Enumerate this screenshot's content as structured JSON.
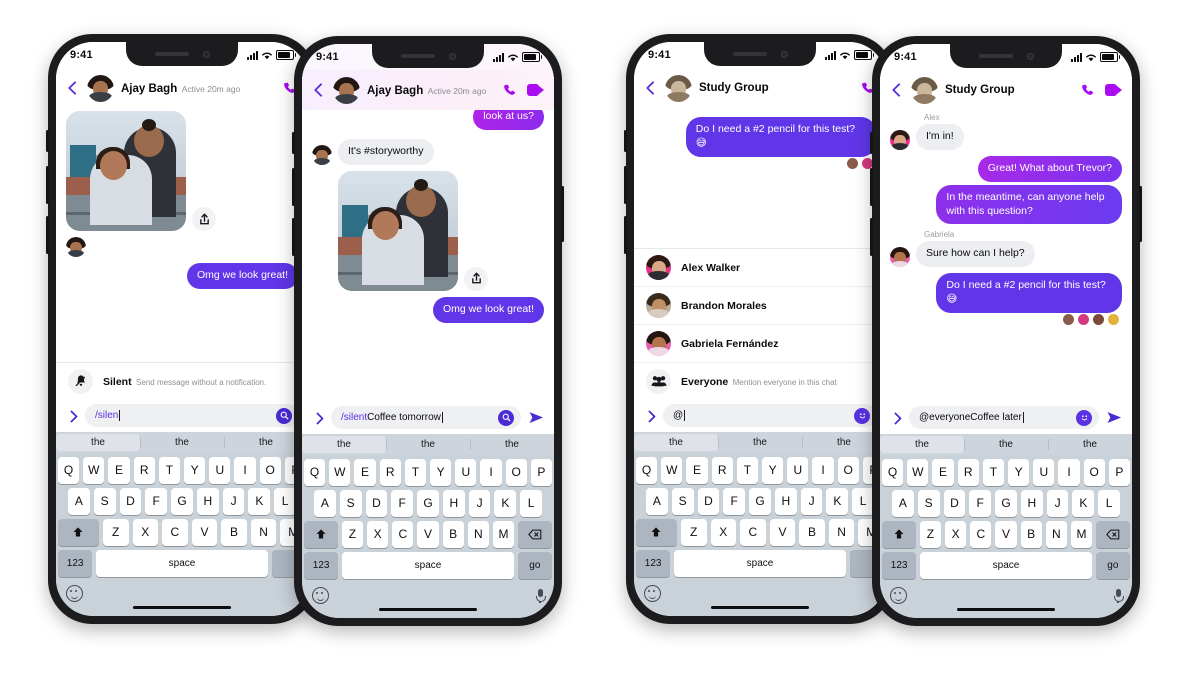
{
  "status_bar": {
    "time": "9:41",
    "signal_icon": "cellular-bars-icon",
    "wifi_icon": "wifi-icon",
    "battery_icon": "battery-icon"
  },
  "keyboard": {
    "predictions": [
      "the",
      "the",
      "the"
    ],
    "row1": [
      "Q",
      "W",
      "E",
      "R",
      "T",
      "Y",
      "U",
      "I",
      "O",
      "P"
    ],
    "row2": [
      "A",
      "S",
      "D",
      "F",
      "G",
      "H",
      "J",
      "K",
      "L"
    ],
    "row3_shift": "shift-icon",
    "row3": [
      "Z",
      "X",
      "C",
      "V",
      "B",
      "N",
      "M"
    ],
    "row3_delete": "delete-icon",
    "numeric_key": "123",
    "space_key": "space",
    "action_key": "go",
    "emoji_key": "emoji-icon",
    "mic_key": "microphone-icon"
  },
  "phones": [
    {
      "id": "phone-1",
      "header": {
        "name": "Ajay Bagh",
        "status": "Active 20m ago",
        "back": "back-icon",
        "call": "phone-call-icon",
        "avatar": "contact-avatar",
        "gradient": false,
        "video_visible": false
      },
      "messages": [
        {
          "type": "photo",
          "side": "in",
          "share": "share-icon",
          "caption": "rooftop-photo"
        },
        {
          "type": "text",
          "side": "out",
          "text": "Omg we look great!",
          "style": "solid"
        }
      ],
      "sheet": {
        "type": "command",
        "icon": "bell-slash-icon",
        "title": "Silent",
        "subtitle": "Send message without a notification."
      },
      "composer": {
        "command": "/silen",
        "rest": "",
        "placeholder": "Aa",
        "left_icon": "chevron-right-icon",
        "right_icon": "search-icon",
        "send_visible": false
      },
      "keyboard_clipped": true
    },
    {
      "id": "phone-2",
      "header": {
        "name": "Ajay Bagh",
        "status": "Active 20m ago",
        "back": "back-icon",
        "call": "phone-call-icon",
        "avatar": "contact-avatar",
        "gradient": true,
        "video_visible": true
      },
      "messages": [
        {
          "type": "text",
          "side": "out",
          "text": "look at us?",
          "style": "grad-a",
          "clipped": true
        },
        {
          "type": "text",
          "side": "in",
          "text": "It's #storyworthy"
        },
        {
          "type": "photo",
          "side": "in",
          "share": "share-icon",
          "caption": "rooftop-photo"
        },
        {
          "type": "text",
          "side": "out",
          "text": "Omg we look great!",
          "style": "solid"
        }
      ],
      "sheet": null,
      "composer": {
        "command": "/silent",
        "rest": " Coffee tomorrow",
        "left_icon": "chevron-right-icon",
        "right_icon": "search-icon",
        "send_visible": true,
        "send_icon": "send-icon"
      },
      "keyboard_clipped": true
    },
    {
      "id": "phone-3",
      "header": {
        "name": "Study Group",
        "status": "",
        "back": "back-icon",
        "call": "phone-call-icon",
        "avatar": "group-avatar",
        "gradient": false,
        "video_visible": false
      },
      "messages": [
        {
          "type": "text",
          "side": "out",
          "text": "Do I need a #2 pencil for this test? 😅",
          "style": "solid"
        }
      ],
      "reactions": 2,
      "sheet": {
        "type": "mentions",
        "items": [
          {
            "name": "Alex Walker",
            "subtitle": "",
            "avatar": "avatar-alex"
          },
          {
            "name": "Brandon Morales",
            "subtitle": "",
            "avatar": "avatar-brandon"
          },
          {
            "name": "Gabriela Fernández",
            "subtitle": "",
            "avatar": "avatar-gabriela"
          },
          {
            "name": "Everyone",
            "subtitle": "Mention everyone in this chat",
            "avatar": "group-people-icon"
          }
        ]
      },
      "composer": {
        "command": "@",
        "rest": "",
        "left_icon": "chevron-right-icon",
        "right_icon": "emoji-icon",
        "send_visible": false
      },
      "keyboard_clipped": true
    },
    {
      "id": "phone-4",
      "header": {
        "name": "Study Group",
        "status": "",
        "back": "back-icon",
        "call": "phone-call-icon",
        "avatar": "group-avatar",
        "gradient": false,
        "video_visible": true
      },
      "messages": [
        {
          "type": "text",
          "side": "in",
          "sender": "Alex",
          "text": "I'm in!"
        },
        {
          "type": "text",
          "side": "out",
          "text": "Great! What about Trevor?",
          "style": "grad-b"
        },
        {
          "type": "text",
          "side": "out",
          "text": "In the meantime, can anyone help with this question?",
          "style": "grad-c"
        },
        {
          "type": "text",
          "side": "in",
          "sender": "Gabriela",
          "text": "Sure how can I help?"
        },
        {
          "type": "text",
          "side": "out",
          "text": "Do I need a #2 pencil for this test? 😅",
          "style": "solid"
        }
      ],
      "reactions": 4,
      "sheet": null,
      "composer": {
        "command": "@everyone",
        "rest": " Coffee later",
        "left_icon": "chevron-right-icon",
        "right_icon": "emoji-icon",
        "send_visible": true,
        "send_icon": "send-icon"
      },
      "keyboard_clipped": false
    }
  ],
  "colors": {
    "accent_purple": "#6036e8",
    "brand_magenta": "#a90cf0",
    "bubble_in": "#eceef1",
    "keyboard_bg": "#c9d1d9",
    "frame": "#1c1c1e"
  }
}
